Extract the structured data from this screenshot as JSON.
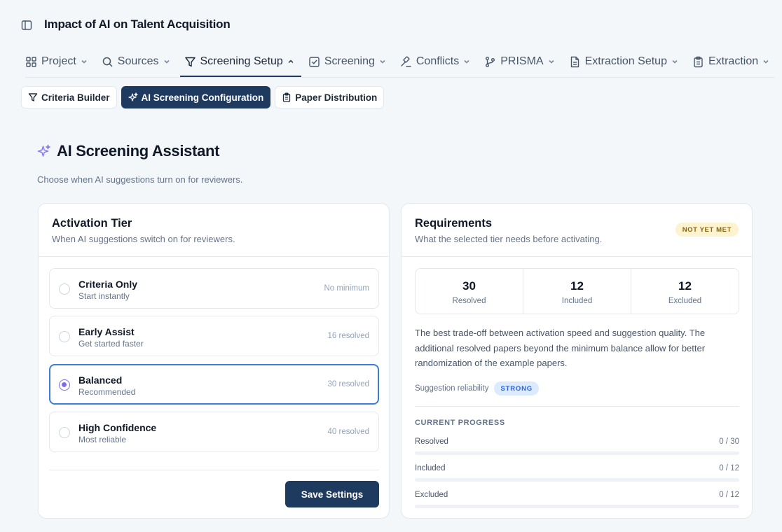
{
  "app": {
    "title": "Impact of AI on Talent Acquisition"
  },
  "nav": {
    "items": [
      {
        "label": "Project"
      },
      {
        "label": "Sources"
      },
      {
        "label": "Screening Setup"
      },
      {
        "label": "Screening"
      },
      {
        "label": "Conflicts"
      },
      {
        "label": "PRISMA"
      },
      {
        "label": "Extraction Setup"
      },
      {
        "label": "Extraction"
      }
    ],
    "active": "Screening Setup"
  },
  "subtabs": {
    "items": [
      {
        "label": "Criteria Builder"
      },
      {
        "label": "AI Screening Configuration"
      },
      {
        "label": "Paper Distribution"
      }
    ],
    "active": "AI Screening Configuration"
  },
  "page": {
    "title": "AI Screening Assistant",
    "subtitle": "Choose when AI suggestions turn on for reviewers."
  },
  "activation": {
    "title": "Activation Tier",
    "description": "When AI suggestions switch on for reviewers.",
    "tiers": [
      {
        "name": "Criteria Only",
        "sub": "Start instantly",
        "requirement": "No minimum"
      },
      {
        "name": "Early Assist",
        "sub": "Get started faster",
        "requirement": "16 resolved"
      },
      {
        "name": "Balanced",
        "sub": "Recommended",
        "requirement": "30 resolved"
      },
      {
        "name": "High Confidence",
        "sub": "Most reliable",
        "requirement": "40 resolved"
      }
    ],
    "selected": "Balanced",
    "save_label": "Save Settings"
  },
  "requirements": {
    "title": "Requirements",
    "description": "What the selected tier needs before activating.",
    "status_badge": "NOT YET MET",
    "stats": [
      {
        "value": "30",
        "label": "Resolved"
      },
      {
        "value": "12",
        "label": "Included"
      },
      {
        "value": "12",
        "label": "Excluded"
      }
    ],
    "tier_text": "The best trade-off between activation speed and suggestion quality. The additional resolved papers beyond the minimum balance allow for better randomization of the example papers.",
    "reliability_label": "Suggestion reliability",
    "reliability_value": "STRONG",
    "progress_title": "CURRENT PROGRESS",
    "progress": [
      {
        "label": "Resolved",
        "value": "0 / 30",
        "fraction": 0
      },
      {
        "label": "Included",
        "value": "0 / 12",
        "fraction": 0
      },
      {
        "label": "Excluded",
        "value": "0 / 12",
        "fraction": 0
      }
    ]
  },
  "colors": {
    "primary": "#1e3a5f",
    "selected_border": "#3b7dd8",
    "radio_accent": "#7c6ee6",
    "sparkle": "#8b7cf0"
  }
}
